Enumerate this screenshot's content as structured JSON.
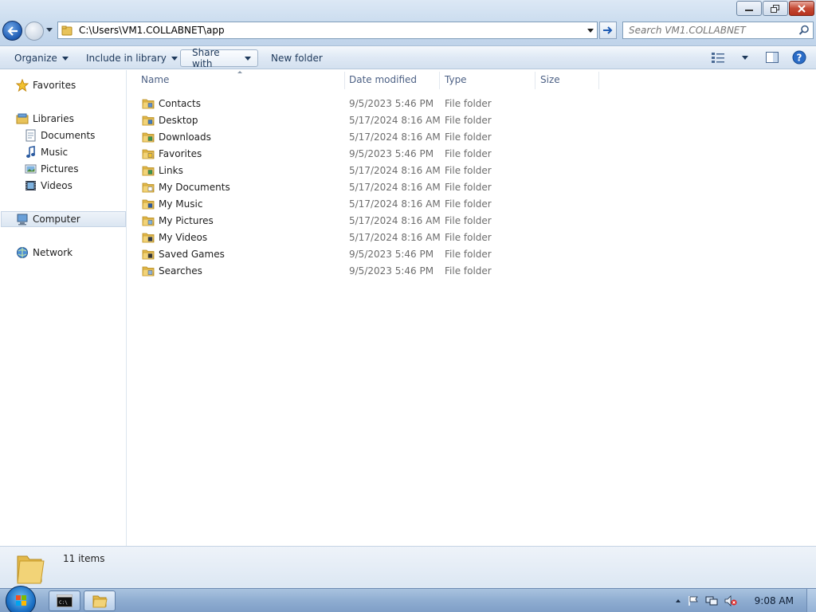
{
  "window": {
    "address_path": "C:\\Users\\VM1.COLLABNET\\app",
    "search_placeholder": "Search VM1.COLLABNET"
  },
  "toolbar": {
    "organize": "Organize",
    "include_in_library": "Include in library",
    "share_with": "Share with",
    "new_folder": "New folder"
  },
  "navigation": {
    "favorites": "Favorites",
    "libraries": "Libraries",
    "documents": "Documents",
    "music": "Music",
    "pictures": "Pictures",
    "videos": "Videos",
    "computer": "Computer",
    "network": "Network"
  },
  "columns": {
    "name": "Name",
    "date_modified": "Date modified",
    "type": "Type",
    "size": "Size"
  },
  "files": [
    {
      "name": "Contacts",
      "date": "9/5/2023 5:46 PM",
      "type": "File folder",
      "icon": "contacts-folder-icon"
    },
    {
      "name": "Desktop",
      "date": "5/17/2024 8:16 AM",
      "type": "File folder",
      "icon": "desktop-folder-icon"
    },
    {
      "name": "Downloads",
      "date": "5/17/2024 8:16 AM",
      "type": "File folder",
      "icon": "downloads-folder-icon"
    },
    {
      "name": "Favorites",
      "date": "9/5/2023 5:46 PM",
      "type": "File folder",
      "icon": "favorites-folder-icon"
    },
    {
      "name": "Links",
      "date": "5/17/2024 8:16 AM",
      "type": "File folder",
      "icon": "links-folder-icon"
    },
    {
      "name": "My Documents",
      "date": "5/17/2024 8:16 AM",
      "type": "File folder",
      "icon": "documents-folder-icon"
    },
    {
      "name": "My Music",
      "date": "5/17/2024 8:16 AM",
      "type": "File folder",
      "icon": "music-folder-icon"
    },
    {
      "name": "My Pictures",
      "date": "5/17/2024 8:16 AM",
      "type": "File folder",
      "icon": "pictures-folder-icon"
    },
    {
      "name": "My Videos",
      "date": "5/17/2024 8:16 AM",
      "type": "File folder",
      "icon": "videos-folder-icon"
    },
    {
      "name": "Saved Games",
      "date": "9/5/2023 5:46 PM",
      "type": "File folder",
      "icon": "saved-games-folder-icon"
    },
    {
      "name": "Searches",
      "date": "9/5/2023 5:46 PM",
      "type": "File folder",
      "icon": "searches-folder-icon"
    }
  ],
  "details": {
    "item_count": "11 items"
  },
  "taskbar": {
    "clock": "9:08 AM"
  },
  "colors": {
    "accent": "#1e5bb3",
    "header_text": "#4d6185",
    "secondary_text": "#6d6d6d"
  }
}
